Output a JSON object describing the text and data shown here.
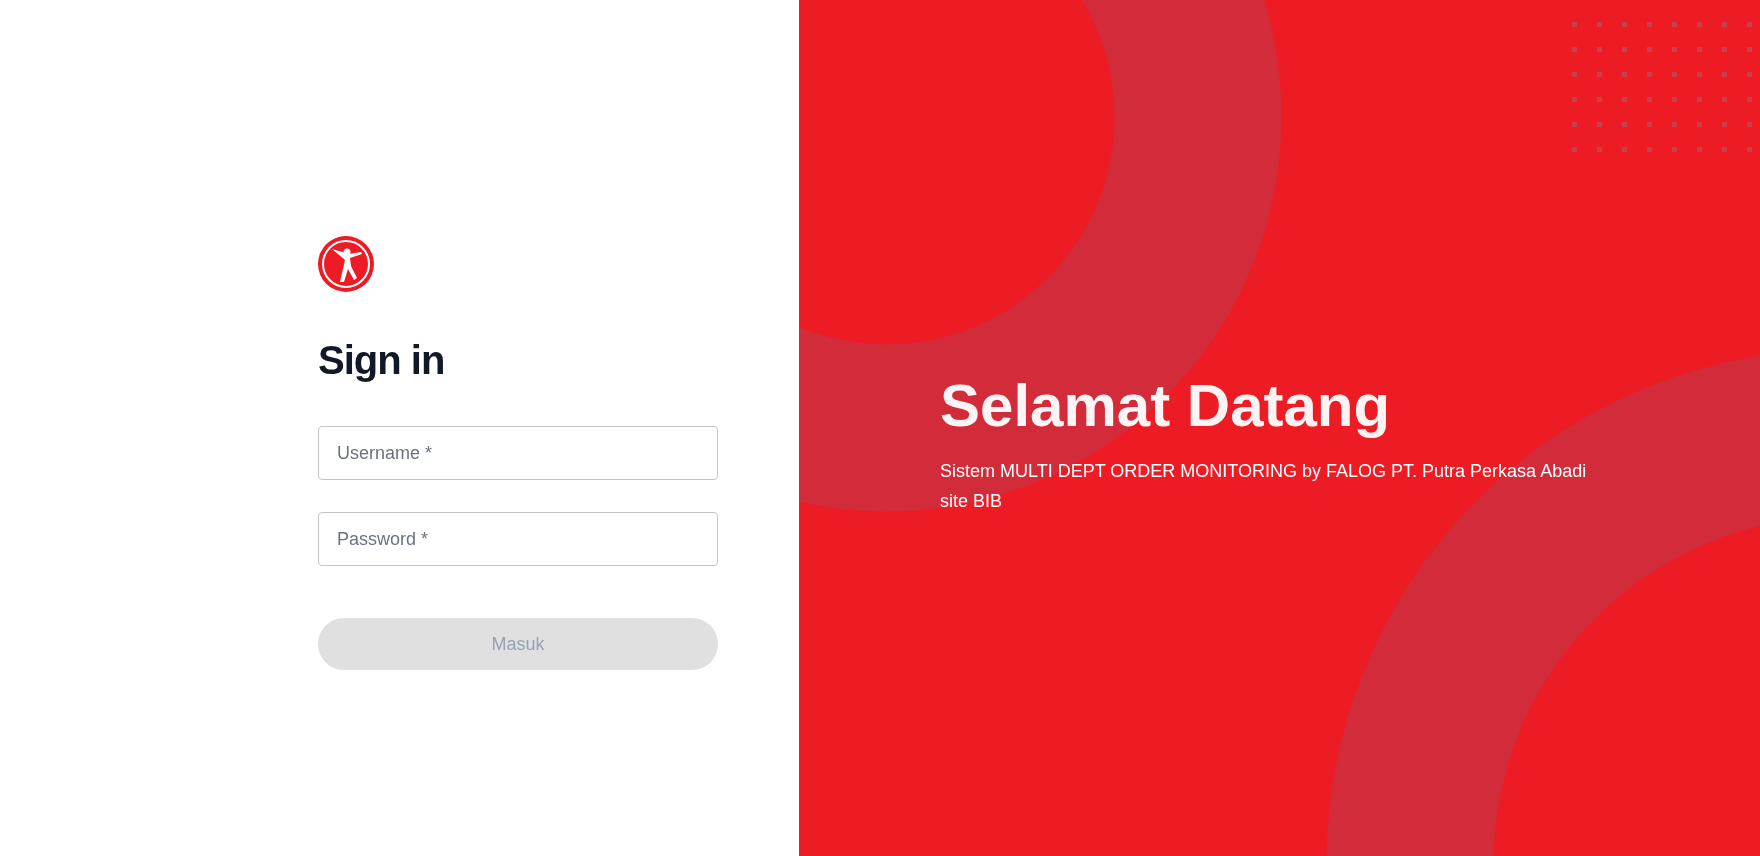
{
  "login": {
    "heading": "Sign in",
    "fields": [
      {
        "placeholder": "Username *"
      },
      {
        "placeholder": "Password *"
      }
    ],
    "submit": {
      "label": "Masuk",
      "disabled": true
    }
  },
  "welcome": {
    "title": "Selamat Datang",
    "subtitle": "Sistem MULTI DEPT ORDER MONITORING by FALOG PT. Putra Perkasa Abadi site BIB"
  }
}
